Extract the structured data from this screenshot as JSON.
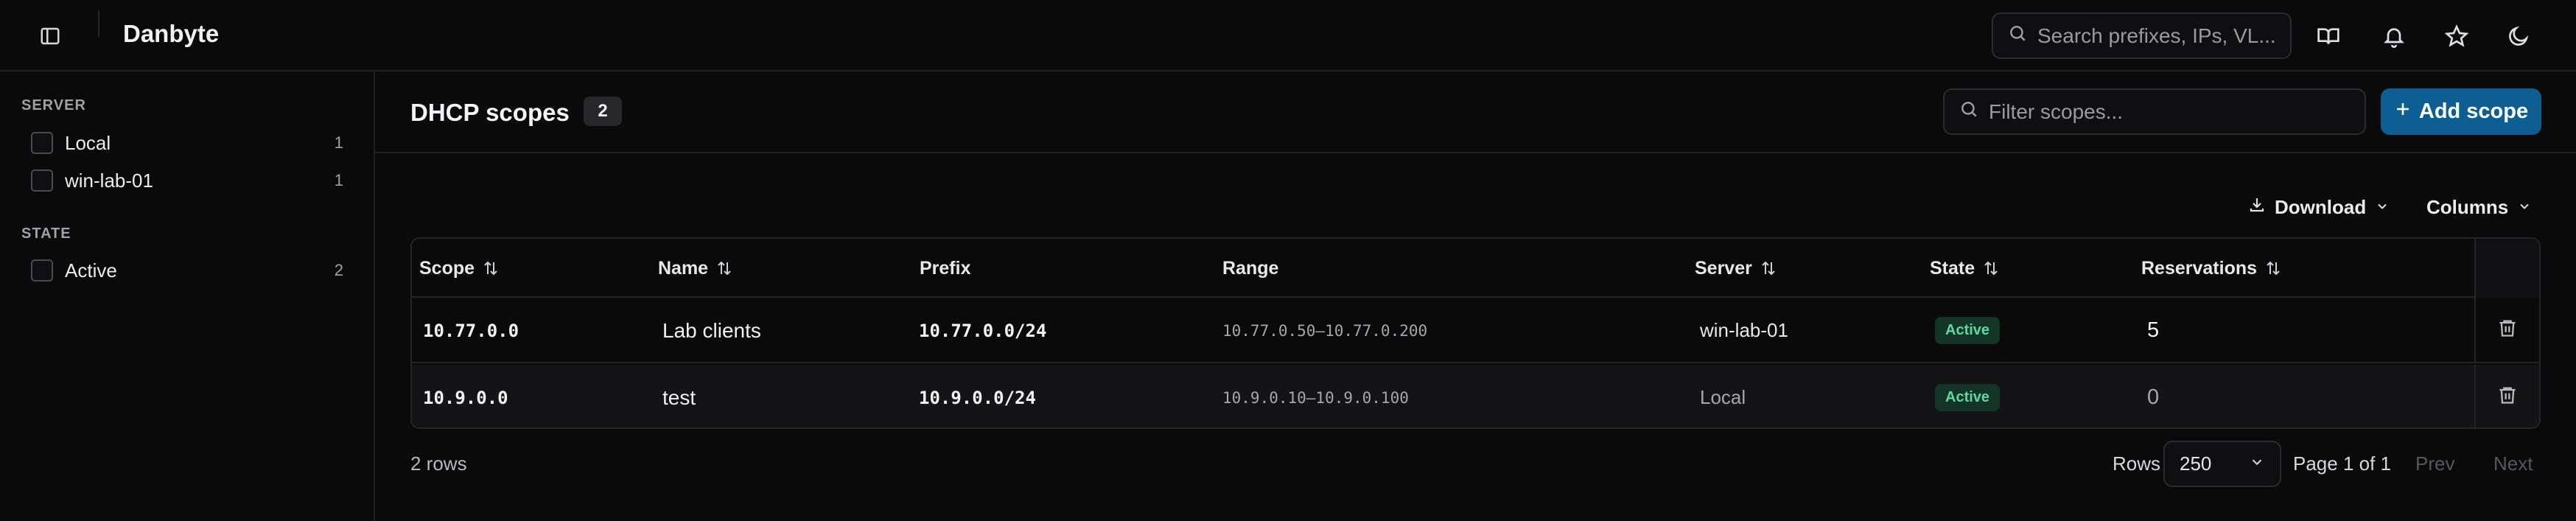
{
  "app": {
    "title": "Danbyte"
  },
  "topbar": {
    "search_placeholder": "Search prefixes, IPs, VL...",
    "icons": [
      "book-icon",
      "bell-icon",
      "star-icon",
      "moon-icon"
    ]
  },
  "sidebar": {
    "groups": [
      {
        "heading": "SERVER",
        "items": [
          {
            "label": "Local",
            "count": "1"
          },
          {
            "label": "win-lab-01",
            "count": "1"
          }
        ]
      },
      {
        "heading": "STATE",
        "items": [
          {
            "label": "Active",
            "count": "2"
          }
        ]
      }
    ]
  },
  "page": {
    "title": "DHCP scopes",
    "count": "2",
    "filter_placeholder": "Filter scopes...",
    "add_button": "Add scope",
    "download_label": "Download",
    "columns_label": "Columns"
  },
  "table": {
    "headers": {
      "scope": "Scope",
      "name": "Name",
      "prefix": "Prefix",
      "range": "Range",
      "server": "Server",
      "state": "State",
      "reservations": "Reservations"
    },
    "rows": [
      {
        "scope": "10.77.0.0",
        "name": "Lab clients",
        "prefix": "10.77.0.0/24",
        "range": "10.77.0.50–10.77.0.200",
        "server": "win-lab-01",
        "state": "Active",
        "reservations": "5"
      },
      {
        "scope": "10.9.0.0",
        "name": "test",
        "prefix": "10.9.0.0/24",
        "range": "10.9.0.10–10.9.0.100",
        "server": "Local",
        "state": "Active",
        "reservations": "0"
      }
    ]
  },
  "footer": {
    "row_count": "2 rows",
    "rows_label": "Rows",
    "rows_per_page": "250",
    "page_info": "Page 1 of 1",
    "prev": "Prev",
    "next": "Next"
  },
  "colors": {
    "accent": "#0d5f93",
    "active_badge_bg": "#123528",
    "active_badge_fg": "#5fd8a0",
    "background": "#0a0a0b"
  }
}
